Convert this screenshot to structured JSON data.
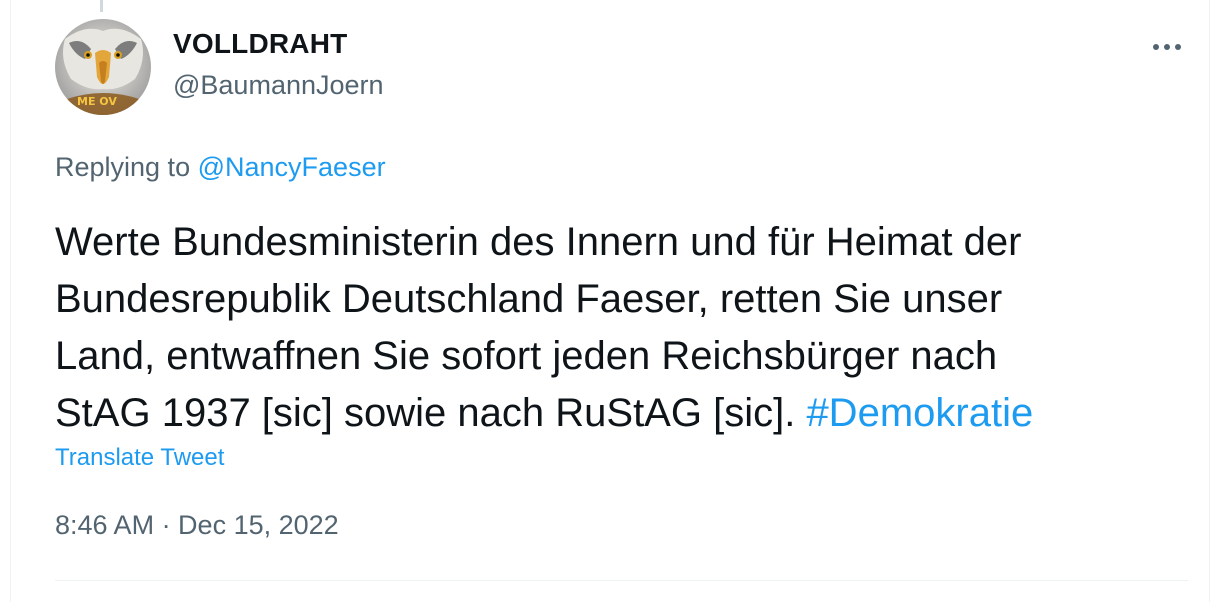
{
  "tweet": {
    "author_name": "VOLLDRAHT",
    "author_handle": "@BaumannJoern",
    "avatar_badge_text": "ME OV",
    "replying_prefix": "Replying to",
    "replying_to": "@NancyFaeser",
    "text_lines": [
      "Werte Bundesministerin des Innern und für Heimat der",
      "Bundesrepublik Deutschland Faeser, retten Sie unser",
      "Land, entwaffnen Sie sofort jeden Reichsbürger nach",
      "StAG 1937 [sic] sowie nach RuStAG [sic]."
    ],
    "hashtag": "#Demokratie",
    "translate_label": "Translate Tweet",
    "timestamp": "8:46 AM · Dec 15, 2022"
  },
  "colors": {
    "link": "#1d9bf0",
    "text": "#0f1419",
    "secondary": "#536471"
  },
  "icons": {
    "more": "more-dots-icon"
  }
}
